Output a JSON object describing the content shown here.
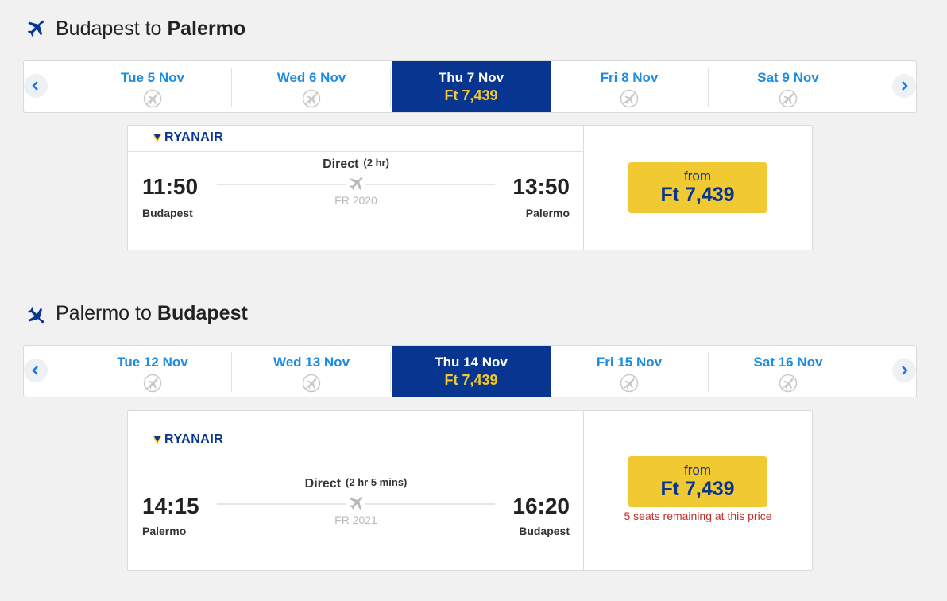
{
  "colors": {
    "brand_blue": "#073590",
    "accent_yellow": "#f1c933",
    "date_link": "#1b8ce3",
    "warning_red": "#c0312b"
  },
  "outbound": {
    "title_from": "Budapest to",
    "title_to": "Palermo",
    "title_icon": "airplane-icon",
    "dates": [
      {
        "label": "Tue 5 Nov",
        "price": null,
        "icon": "no-flight-icon"
      },
      {
        "label": "Wed 6 Nov",
        "price": null,
        "icon": "no-flight-icon"
      },
      {
        "label": "Thu 7 Nov",
        "price": "Ft 7,439",
        "selected": true
      },
      {
        "label": "Fri 8 Nov",
        "price": null,
        "icon": "no-flight-icon"
      },
      {
        "label": "Sat 9 Nov",
        "price": null,
        "icon": "no-flight-icon"
      }
    ],
    "flight": {
      "airline": "RYANAIR",
      "dep_time": "11:50",
      "dep_city": "Budapest",
      "arr_time": "13:50",
      "arr_city": "Palermo",
      "type": "Direct",
      "duration": "(2 hr)",
      "flight_number": "FR 2020",
      "price_prefix": "from",
      "price": "Ft 7,439"
    }
  },
  "inbound": {
    "title_from": "Palermo to",
    "title_to": "Budapest",
    "title_icon": "airplane-icon",
    "dates": [
      {
        "label": "Tue 12 Nov",
        "price": null,
        "icon": "no-flight-icon"
      },
      {
        "label": "Wed 13 Nov",
        "price": null,
        "icon": "no-flight-icon"
      },
      {
        "label": "Thu 14 Nov",
        "price": "Ft 7,439",
        "selected": true
      },
      {
        "label": "Fri 15 Nov",
        "price": null,
        "icon": "no-flight-icon"
      },
      {
        "label": "Sat 16 Nov",
        "price": null,
        "icon": "no-flight-icon"
      }
    ],
    "flight": {
      "airline": "RYANAIR",
      "dep_time": "14:15",
      "dep_city": "Palermo",
      "arr_time": "16:20",
      "arr_city": "Budapest",
      "type": "Direct",
      "duration": "(2 hr 5 mins)",
      "flight_number": "FR 2021",
      "price_prefix": "from",
      "price": "Ft 7,439",
      "seats_note": "5 seats remaining at this price"
    }
  },
  "nav": {
    "prev_icon": "chevron-left-icon",
    "next_icon": "chevron-right-icon"
  }
}
